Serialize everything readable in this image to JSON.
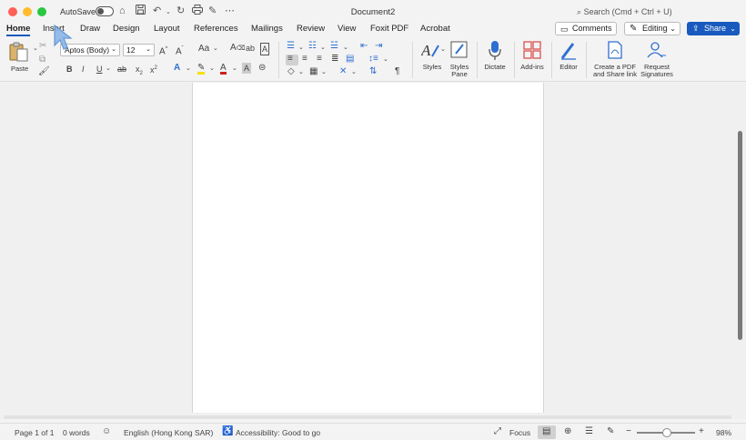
{
  "titlebar": {
    "autosave_label": "AutoSave",
    "document_title": "Document2",
    "search_placeholder": "Search (Cmd + Ctrl + U)"
  },
  "tabs": [
    "Home",
    "Insert",
    "Draw",
    "Design",
    "Layout",
    "References",
    "Mailings",
    "Review",
    "View",
    "Foxit PDF",
    "Acrobat"
  ],
  "header_buttons": {
    "comments": "Comments",
    "editing": "Editing",
    "share": "Share"
  },
  "ribbon": {
    "paste_label": "Paste",
    "font_name": "Aptos (Body)",
    "font_size": "12",
    "styles_label": "Styles",
    "styles_pane_label": "Styles\nPane",
    "dictate_label": "Dictate",
    "addins_label": "Add-ins",
    "editor_label": "Editor",
    "create_pdf_label": "Create a PDF\nand Share link",
    "request_sig_label": "Request\nSignatures"
  },
  "statusbar": {
    "page": "Page 1 of 1",
    "words": "0 words",
    "language": "English (Hong Kong SAR)",
    "accessibility": "Accessibility: Good to go",
    "focus": "Focus",
    "zoom": "98%"
  },
  "colors": {
    "accent": "#185abd",
    "highlight_yellow": "#f5e100",
    "font_red": "#d0201c"
  }
}
